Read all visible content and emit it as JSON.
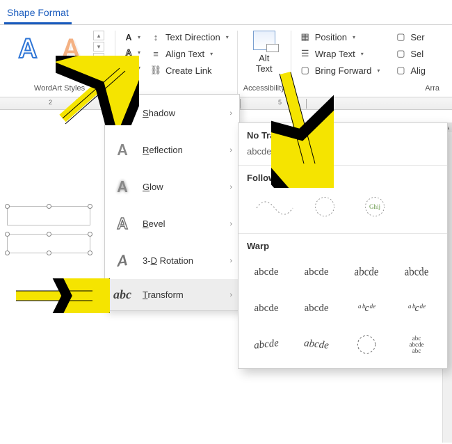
{
  "tab": "Shape Format",
  "groups": {
    "wordart": "WordArt Styles",
    "accessibility": "Accessibility",
    "arrange_partial": "Arra"
  },
  "ribbon": {
    "text_direction": "Text Direction",
    "align_text": "Align Text",
    "create_link": "Create Link",
    "alt_text_1": "Alt",
    "alt_text_2": "Text",
    "position": "Position",
    "wrap_text": "Wrap Text",
    "bring_forward": "Bring Forward",
    "sen": "Ser",
    "sel": "Sel",
    "ali": "Alig"
  },
  "ruler": {
    "n2": "2",
    "n5": "5"
  },
  "flyout": {
    "items": [
      {
        "label": "Shadow",
        "accel": "S"
      },
      {
        "label": "Reflection",
        "accel": "R"
      },
      {
        "label": "Glow",
        "accel": "G"
      },
      {
        "label": "Bevel",
        "accel": "B"
      },
      {
        "label": "3-D Rotation",
        "accel": "D"
      },
      {
        "label": "Transform",
        "accel": "T"
      }
    ]
  },
  "transform": {
    "no_transform": "No Transform",
    "sample": "abcde",
    "follow_path": "Follow Path",
    "warp": "Warp",
    "warp_sample": "abcde"
  }
}
